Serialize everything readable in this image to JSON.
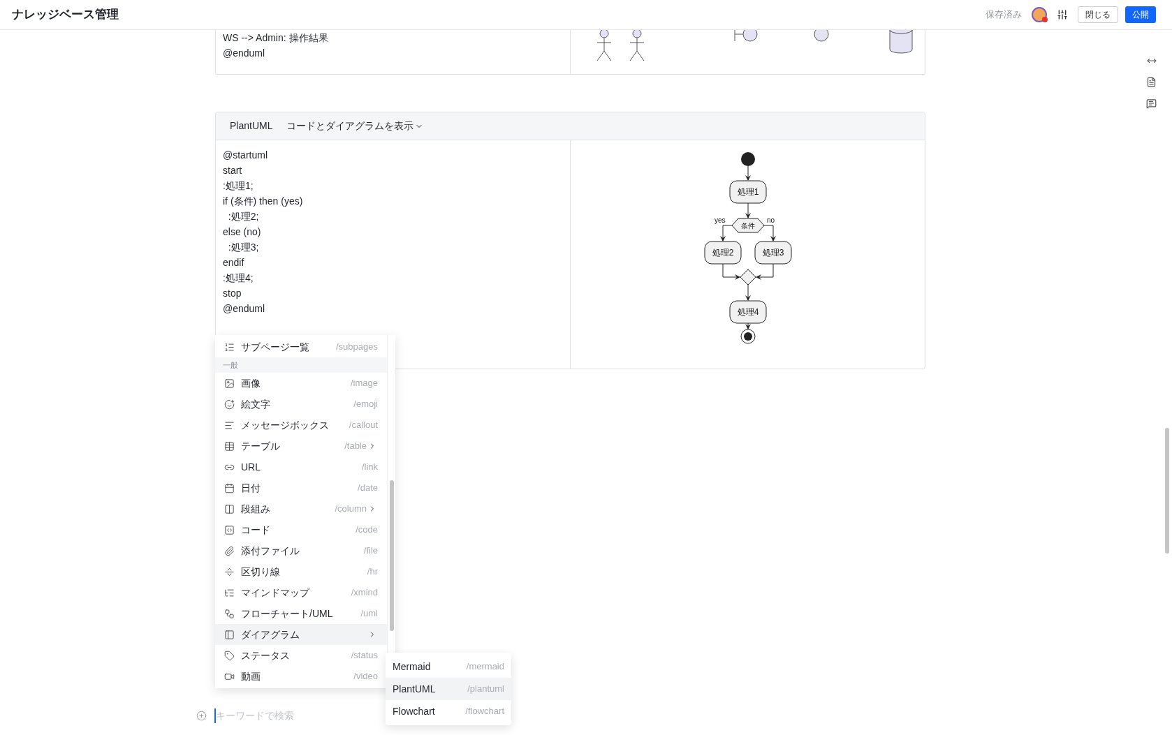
{
  "header": {
    "title": "ナレッジベース管理",
    "status": "保存済み",
    "buttons": [
      {
        "label": "閉じる",
        "kind": "outline"
      },
      {
        "label": "公開",
        "kind": "primary"
      }
    ]
  },
  "top_block": {
    "code_lines": [
      "WS --> Admin: 操作結果",
      "@enduml"
    ]
  },
  "plantuml_block": {
    "language": "PlantUML",
    "view_mode": "コードとダイアグラムを表示",
    "code_lines": [
      "@startuml",
      "start",
      ":処理1;",
      "if (条件) then (yes)",
      "  :処理2;",
      "else (no)",
      "  :処理3;",
      "endif",
      ":処理4;",
      "stop",
      "@enduml"
    ],
    "diagram": {
      "nodes": [
        "処理1",
        "処理2",
        "処理3",
        "処理4"
      ],
      "condition": "条件",
      "yes_label": "yes",
      "no_label": "no"
    }
  },
  "menu": {
    "items": [
      {
        "kind": "item",
        "label": "サブページ一覧",
        "command": "/subpages",
        "has_submenu": false,
        "selected": false
      },
      {
        "kind": "section",
        "label": "一般"
      },
      {
        "kind": "item",
        "label": "画像",
        "command": "/image",
        "has_submenu": false,
        "selected": false
      },
      {
        "kind": "item",
        "label": "絵文字",
        "command": "/emoji",
        "has_submenu": false,
        "selected": false
      },
      {
        "kind": "item",
        "label": "メッセージボックス",
        "command": "/callout",
        "has_submenu": false,
        "selected": false
      },
      {
        "kind": "item",
        "label": "テーブル",
        "command": "/table",
        "has_submenu": true,
        "selected": false
      },
      {
        "kind": "item",
        "label": "URL",
        "command": "/link",
        "has_submenu": false,
        "selected": false
      },
      {
        "kind": "item",
        "label": "日付",
        "command": "/date",
        "has_submenu": false,
        "selected": false
      },
      {
        "kind": "item",
        "label": "段組み",
        "command": "/column",
        "has_submenu": true,
        "selected": false
      },
      {
        "kind": "item",
        "label": "コード",
        "command": "/code",
        "has_submenu": false,
        "selected": false
      },
      {
        "kind": "item",
        "label": "添付ファイル",
        "command": "/file",
        "has_submenu": false,
        "selected": false
      },
      {
        "kind": "item",
        "label": "区切り線",
        "command": "/hr",
        "has_submenu": false,
        "selected": false
      },
      {
        "kind": "item",
        "label": "マインドマップ",
        "command": "/xmind",
        "has_submenu": false,
        "selected": false
      },
      {
        "kind": "item",
        "label": "フローチャート/UML",
        "command": "/uml",
        "has_submenu": false,
        "selected": false
      },
      {
        "kind": "item",
        "label": "ダイアグラム",
        "has_submenu": true,
        "selected": true
      },
      {
        "kind": "item",
        "label": "ステータス",
        "command": "/status",
        "has_submenu": false,
        "selected": false
      },
      {
        "kind": "item",
        "label": "動画",
        "command": "/video",
        "has_submenu": false,
        "selected": false
      }
    ],
    "submenu": [
      {
        "label": "Mermaid",
        "command": "/mermaid",
        "selected": false
      },
      {
        "label": "PlantUML",
        "command": "/plantuml",
        "selected": true
      },
      {
        "label": "Flowchart",
        "command": "/flowchart",
        "selected": false
      }
    ]
  },
  "search": {
    "placeholder": "キーワードで検索"
  }
}
